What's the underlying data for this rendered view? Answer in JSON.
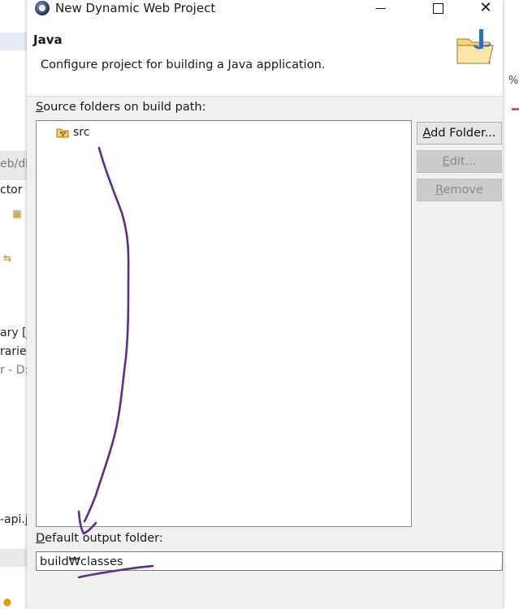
{
  "window": {
    "title": "New Dynamic Web Project"
  },
  "header": {
    "title": "Java",
    "description": "Configure project for building a Java application."
  },
  "source_folders": {
    "label_mnemonic": "S",
    "label_rest": "ource folders on build path:",
    "items": [
      "src"
    ]
  },
  "buttons": {
    "add_folder_mnemonic": "A",
    "add_folder_rest": "dd Folder...",
    "edit_mnemonic": "E",
    "edit_rest": "dit...",
    "remove_mnemonic": "R",
    "remove_rest": "emove"
  },
  "output_folder": {
    "label_mnemonic": "D",
    "label_rest": "efault output folder:",
    "value": "build₩classes"
  },
  "background": {
    "left_fragments": [
      "eb/dl",
      "ctor",
      "ary [j",
      "raries",
      "r - D:",
      "-api.ja"
    ],
    "right_fragments": [
      "%"
    ]
  },
  "colors": {
    "annotation_stroke": "#5b2d8e",
    "button_disabled_text": "#8a8a8a"
  }
}
